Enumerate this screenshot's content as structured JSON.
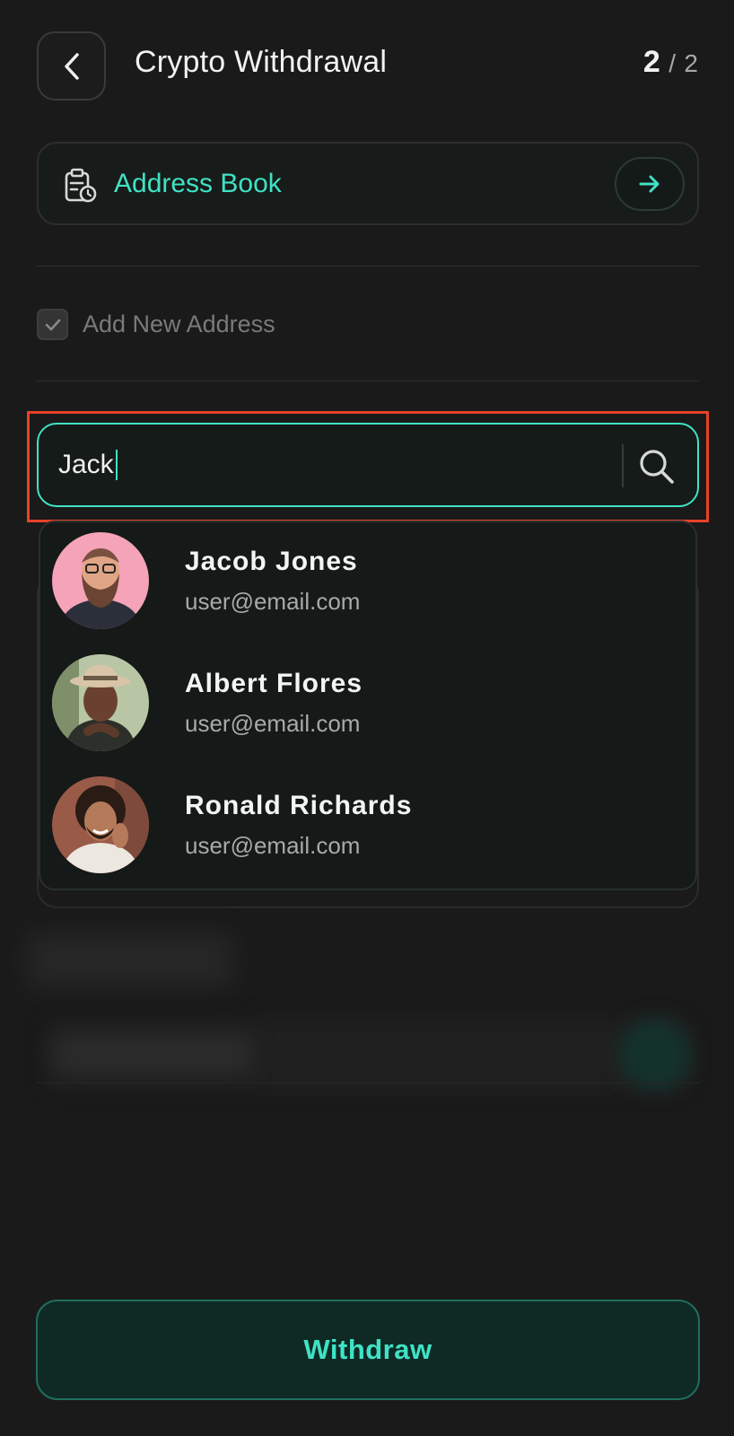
{
  "header": {
    "title": "Crypto Withdrawal",
    "step_current": "2",
    "step_separator": "/",
    "step_total": "2"
  },
  "address_book": {
    "label": "Address Book"
  },
  "add_new_address": {
    "label": "Add New Address",
    "checked": true
  },
  "search": {
    "value": "Jack"
  },
  "contacts": [
    {
      "name": "Jacob Jones",
      "email": "user@email.com",
      "avatar_bg": "#f4a3b9"
    },
    {
      "name": "Albert Flores",
      "email": "user@email.com",
      "avatar_bg": "#b8c6a6"
    },
    {
      "name": "Ronald Richards",
      "email": "user@email.com",
      "avatar_bg": "#9a5a48"
    }
  ],
  "footer": {
    "withdraw_label": "Withdraw"
  },
  "colors": {
    "accent": "#3fe2c4",
    "highlight": "#e8412a",
    "background": "#1a1a1a"
  }
}
